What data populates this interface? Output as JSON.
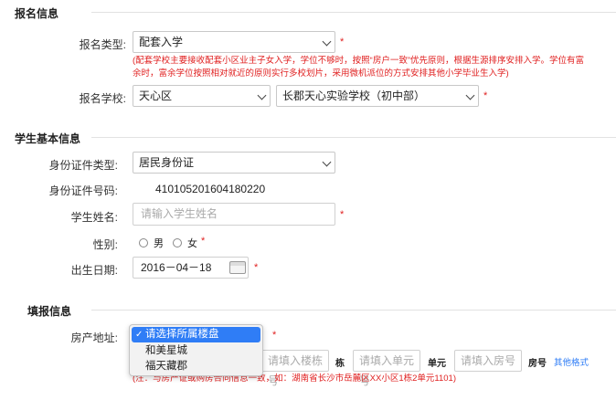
{
  "sections": {
    "registration": "报名信息",
    "student": "学生基本信息",
    "fill": "填报信息"
  },
  "registration": {
    "type_label": "报名类型:",
    "type_value": "配套入学",
    "type_note_line1": "(配套学校主要接收配套小区业主子女入学，学位不够时，按照“房户一致”优先原则，根据生源排序安排入学。学位有富",
    "type_note_line2": "余时，富余学位按照相对就近的原则实行多校划片，采用微机派位的方式安排其他小学毕业生入学)",
    "school_label": "报名学校:",
    "district_value": "天心区",
    "school_value": "长郡天心实验学校（初中部）",
    "required_mark": "*"
  },
  "student": {
    "id_type_label": "身份证件类型:",
    "id_type_value": "居民身份证",
    "id_number_label": "身份证件号码:",
    "id_number_value": "410105201604180220",
    "name_label": "学生姓名:",
    "name_placeholder": "请输入学生姓名",
    "gender_label": "性别:",
    "gender_male": "男",
    "gender_female": "女",
    "birth_label": "出生日期:",
    "birth_value": "2016－04－18",
    "required_mark": "*"
  },
  "fill": {
    "address_label": "房产地址:",
    "building_placeholder": "请填入楼栋号",
    "building_unit": "栋",
    "unit_placeholder": "请填入单元号",
    "unit_unit": "单元",
    "room_placeholder": "请填入房号",
    "room_unit": "房号",
    "other_format_link": "其他格式",
    "note": "(注：与房产证或购房合同信息一致，如：湖南省长沙市岳麓区XX小区1栋2单元1101)",
    "required_mark": "*",
    "dropdown": {
      "options": [
        "请选择所属楼盘",
        "和美星城",
        "福天藏郡"
      ],
      "selected_index": 0,
      "check_glyph": "✓"
    }
  },
  "colors": {
    "required": "#e02020",
    "accent": "#2f7df6",
    "divider": "#e2e2e2"
  }
}
